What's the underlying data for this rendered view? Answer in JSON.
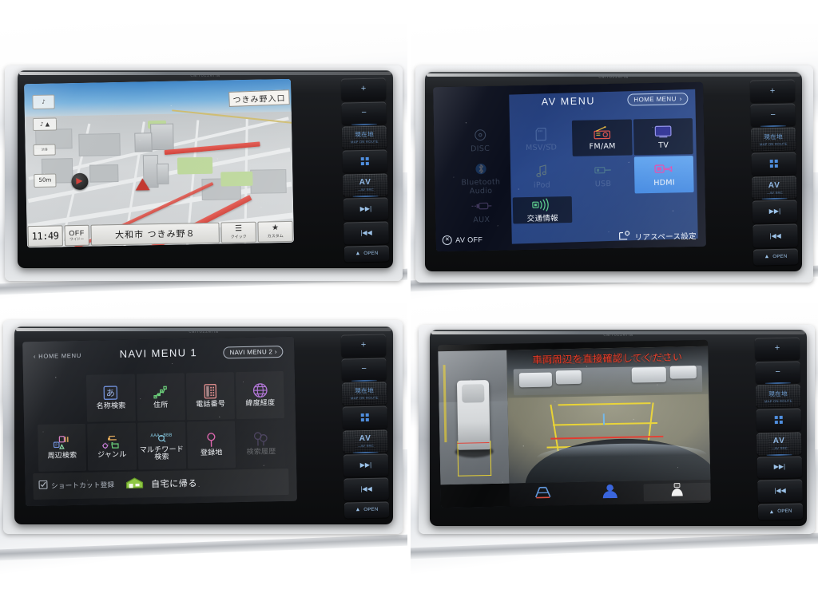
{
  "collage": {
    "title": "Car navigation head unit screens (2x2 photo collage)",
    "panels": [
      {
        "id": "map",
        "caption": "Navigation map view"
      },
      {
        "id": "av-menu",
        "caption": "AV MENU source selection"
      },
      {
        "id": "navi-menu",
        "caption": "NAVI MENU 1 destination search"
      },
      {
        "id": "camera",
        "caption": "Rear view camera with side camera"
      }
    ]
  },
  "unit": {
    "brand": "carrozzeria",
    "hard_keys": [
      {
        "name": "volume-up",
        "glyph": "+",
        "label": "",
        "sub": ""
      },
      {
        "name": "volume-down",
        "glyph": "−",
        "label": "",
        "sub": ""
      },
      {
        "name": "current-location",
        "glyph": "",
        "label": "現在地",
        "sub": "MAP ON ROUTE"
      },
      {
        "name": "menu-grid",
        "glyph": "",
        "label": "",
        "sub": ""
      },
      {
        "name": "av-source",
        "glyph": "",
        "label": "AV",
        "sub": "→AV SRC"
      },
      {
        "name": "track-next",
        "glyph": "▶▶|",
        "label": "",
        "sub": ""
      },
      {
        "name": "track-prev",
        "glyph": "|◀◀",
        "label": "",
        "sub": ""
      },
      {
        "name": "eject-open",
        "glyph": "▲",
        "label": "OPEN",
        "sub": ""
      }
    ]
  },
  "map_screen": {
    "destination_label": "つきみ野入口",
    "clock": "11:49",
    "wide_button": {
      "line1": "OFF",
      "line2": "ワイドー"
    },
    "address": "大和市 つきみ野８",
    "scale": "50m",
    "overlay_buttons": [
      {
        "name": "traffic-info",
        "line1": "渋滞",
        "line2": "情報"
      },
      {
        "name": "audio-mini",
        "line1": "♪ ▲",
        "line2": ""
      },
      {
        "name": "jam-toggle",
        "line1": "渋滞",
        "line2": ""
      }
    ],
    "quick_button": {
      "icon": "☰",
      "label": "クイック"
    },
    "custom_button": {
      "icon": "★",
      "label": "カスタム"
    }
  },
  "av_screen": {
    "title": "AV MENU",
    "home_menu": "HOME MENU",
    "home_menu_chevron": "›",
    "av_off": "AV OFF",
    "rear_space": "リアスペース設定",
    "selected_source": "HDMI",
    "accent_selected": "#4f93e8",
    "panel_color": "#2b4a8e",
    "items": [
      {
        "name": "disc",
        "label": "DISC",
        "state": "disabled",
        "icon": "disc-icon"
      },
      {
        "name": "msv-sd",
        "label": "MSV/SD",
        "state": "disabled",
        "icon": "sd-card-icon"
      },
      {
        "name": "fm-am",
        "label": "FM/AM",
        "state": "enabled",
        "icon": "radio-icon"
      },
      {
        "name": "tv",
        "label": "TV",
        "state": "enabled",
        "icon": "tv-icon"
      },
      {
        "name": "bluetooth-audio",
        "label": "Bluetooth Audio",
        "state": "disabled",
        "icon": "bluetooth-icon"
      },
      {
        "name": "ipod",
        "label": "iPod",
        "state": "disabled",
        "icon": "ipod-icon"
      },
      {
        "name": "usb",
        "label": "USB",
        "state": "disabled",
        "icon": "usb-icon"
      },
      {
        "name": "hdmi",
        "label": "HDMI",
        "state": "selected",
        "icon": "hdmi-icon"
      },
      {
        "name": "aux",
        "label": "AUX",
        "state": "disabled",
        "icon": "aux-plug-icon"
      },
      {
        "name": "traffic-info",
        "label": "交通情報",
        "state": "enabled",
        "icon": "broadcast-icon"
      }
    ]
  },
  "navi_screen": {
    "title": "NAVI MENU 1",
    "home_menu": "HOME MENU",
    "home_chevron": "‹",
    "next_menu": "NAVI MENU 2",
    "next_chevron": "›",
    "shortcut": "ショートカット登録",
    "go_home": "自宅に帰る",
    "items": [
      {
        "name": "name-search",
        "label": "名称検索",
        "state": "enabled",
        "icon": "kana-a-icon"
      },
      {
        "name": "address-search",
        "label": "住所",
        "state": "enabled",
        "icon": "japan-map-icon"
      },
      {
        "name": "phone-number",
        "label": "電話番号",
        "state": "enabled",
        "icon": "telephone-icon"
      },
      {
        "name": "lat-long",
        "label": "緯度経度",
        "state": "enabled",
        "icon": "globe-icon"
      },
      {
        "name": "nearby-search",
        "label": "周辺検索",
        "state": "enabled",
        "icon": "poi-icon"
      },
      {
        "name": "genre-search",
        "label": "ジャンル",
        "state": "enabled",
        "icon": "genre-icon"
      },
      {
        "name": "multiword-search",
        "label": "マルチワード検索",
        "state": "enabled",
        "icon": "multiword-icon"
      },
      {
        "name": "saved-places",
        "label": "登録地",
        "state": "enabled",
        "icon": "pin-icon"
      },
      {
        "name": "search-history",
        "label": "検索履歴",
        "state": "disabled",
        "icon": "history-pin-icon"
      }
    ]
  },
  "camera_screen": {
    "warning": "車両周辺を直接確認してください",
    "warning_ghost": "車両周辺を直接確認してください",
    "guide_color_yellow": "#e8d233",
    "guide_color_red": "#e0372b",
    "controls": [
      {
        "name": "guideline-toggle",
        "icon": "guideline-icon",
        "label": ""
      },
      {
        "name": "rear-view-mode",
        "icon": "person-rear-icon",
        "label": ""
      },
      {
        "name": "top-view-mode",
        "icon": "top-view-icon",
        "label": ""
      }
    ]
  }
}
